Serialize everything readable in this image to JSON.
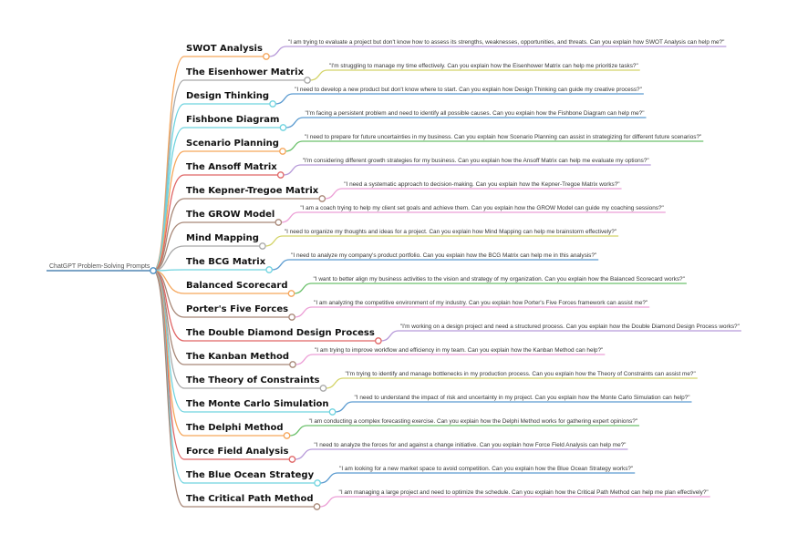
{
  "root": {
    "label": "ChatGPT Problem-Solving Prompts",
    "color": "#2e6da4",
    "node_color": "#4a90c4"
  },
  "topics": [
    {
      "title": "SWOT Analysis",
      "branch_color": "#f5a65b",
      "prompt_color": "#b79ad9",
      "prompt": "\"I am trying to evaluate a project but don't know how to assess its strengths, weaknesses, opportunities, and threats. Can you explain how SWOT Analysis can help me?\""
    },
    {
      "title": "The Eisenhower Matrix",
      "branch_color": "#a9a9a9",
      "prompt_color": "#d4d46a",
      "prompt": "\"I'm struggling to manage my time effectively. Can you explain how the Eisenhower Matrix can help me prioritize tasks?\""
    },
    {
      "title": "Design Thinking",
      "branch_color": "#6fd3df",
      "prompt_color": "#5b9bd0",
      "prompt": "\"I need to develop a new product but don't know where to start. Can you explain how Design Thinking can guide my creative process?\""
    },
    {
      "title": "Fishbone Diagram",
      "branch_color": "#6fd3df",
      "prompt_color": "#5b9bd0",
      "prompt": "\"I'm facing a persistent problem and need to identify all possible causes. Can you explain how the Fishbone Diagram can help me?\""
    },
    {
      "title": "Scenario Planning",
      "branch_color": "#f5a65b",
      "prompt_color": "#6cc16c",
      "prompt": "\"I need to prepare for future uncertainties in my business. Can you explain how Scenario Planning can assist in strategizing for different future scenarios?\""
    },
    {
      "title": "The Ansoff Matrix",
      "branch_color": "#e06666",
      "prompt_color": "#b79ad9",
      "prompt": "\"I'm considering different growth strategies for my business. Can you explain how the Ansoff Matrix can help me evaluate my options?\""
    },
    {
      "title": "The Kepner-Tregoe Matrix",
      "branch_color": "#a88878",
      "prompt_color": "#ec9fd6",
      "prompt": "\"I need a systematic approach to decision-making. Can you explain how the Kepner-Tregoe Matrix works?\""
    },
    {
      "title": "The GROW Model",
      "branch_color": "#a88878",
      "prompt_color": "#ec9fd6",
      "prompt": "\"I am a coach trying to help my client set goals and achieve them. Can you explain how the GROW Model can guide my coaching sessions?\""
    },
    {
      "title": "Mind Mapping",
      "branch_color": "#a9a9a9",
      "prompt_color": "#d4d46a",
      "prompt": "\"I need to organize my thoughts and ideas for a project. Can you explain how Mind Mapping can help me brainstorm effectively?\""
    },
    {
      "title": "The BCG Matrix",
      "branch_color": "#6fd3df",
      "prompt_color": "#5b9bd0",
      "prompt": "\"I need to analyze my company's product portfolio. Can you explain how the BCG Matrix can help me in this analysis?\""
    },
    {
      "title": "Balanced Scorecard",
      "branch_color": "#f5a65b",
      "prompt_color": "#6cc16c",
      "prompt": "\"I want to better align my business activities to the vision and strategy of my organization. Can you explain how the Balanced Scorecard works?\""
    },
    {
      "title": "Porter's Five Forces",
      "branch_color": "#a88878",
      "prompt_color": "#ec9fd6",
      "prompt": "\"I am analyzing the competitive environment of my industry. Can you explain how Porter's Five Forces framework can assist me?\""
    },
    {
      "title": "The Double Diamond Design Process",
      "branch_color": "#e06666",
      "prompt_color": "#b79ad9",
      "prompt": "\"I'm working on a design project and need a structured process. Can you explain how the Double Diamond Design Process works?\""
    },
    {
      "title": "The Kanban Method",
      "branch_color": "#a88878",
      "prompt_color": "#ec9fd6",
      "prompt": "\"I am trying to improve workflow and efficiency in my team. Can you explain how the Kanban Method can help?\""
    },
    {
      "title": "The Theory of Constraints",
      "branch_color": "#a9a9a9",
      "prompt_color": "#d4d46a",
      "prompt": "\"I'm trying to identify and manage bottlenecks in my production process. Can you explain how the Theory of Constraints can assist me?\""
    },
    {
      "title": "The Monte Carlo Simulation",
      "branch_color": "#6fd3df",
      "prompt_color": "#5b9bd0",
      "prompt": "\"I need to understand the impact of risk and uncertainty in my project. Can you explain how the Monte Carlo Simulation can help?\""
    },
    {
      "title": "The Delphi Method",
      "branch_color": "#f5a65b",
      "prompt_color": "#6cc16c",
      "prompt": "\"I am conducting a complex forecasting exercise. Can you explain how the Delphi Method works for gathering expert opinions?\""
    },
    {
      "title": "Force Field Analysis",
      "branch_color": "#e06666",
      "prompt_color": "#b79ad9",
      "prompt": "\"I need to analyze the forces for and against a change initiative. Can you explain how Force Field Analysis can help me?\""
    },
    {
      "title": "The Blue Ocean Strategy",
      "branch_color": "#6fd3df",
      "prompt_color": "#5b9bd0",
      "prompt": "\"I am looking for a new market space to avoid competition. Can you explain how the Blue Ocean Strategy works?\""
    },
    {
      "title": "The Critical Path Method",
      "branch_color": "#a88878",
      "prompt_color": "#ec9fd6",
      "prompt": "\"I am managing a large project and need to optimize the schedule. Can you explain how the Critical Path Method can help me plan effectively?\""
    }
  ]
}
